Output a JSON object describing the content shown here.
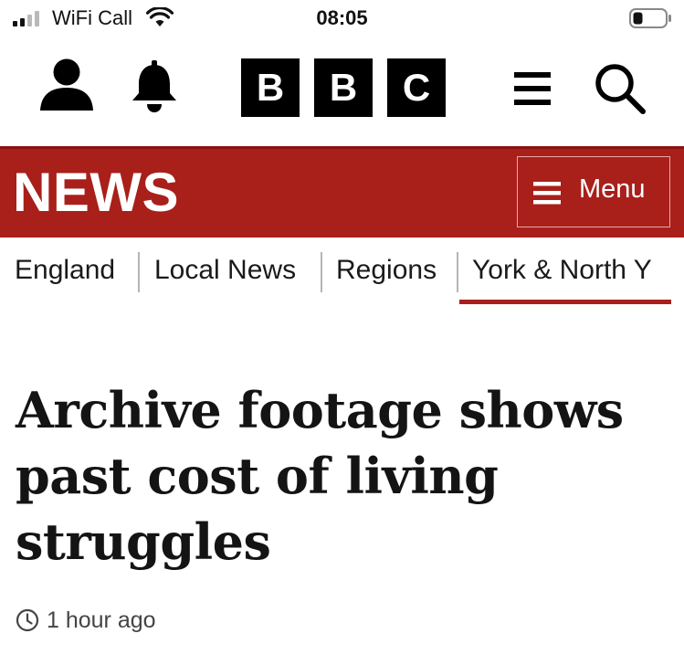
{
  "status_bar": {
    "carrier": "WiFi Call",
    "time": "08:05",
    "icons": [
      "signal-bars-icon",
      "wifi-icon",
      "battery-icon"
    ]
  },
  "header": {
    "logo_letters": [
      "B",
      "B",
      "C"
    ],
    "icons": [
      "account-icon",
      "notifications-bell-icon",
      "hamburger-menu-icon",
      "search-icon"
    ]
  },
  "news_band": {
    "title": "NEWS",
    "menu_label": "Menu",
    "background_color": "#a91f1a"
  },
  "sub_nav": {
    "items": [
      {
        "label": "England"
      },
      {
        "label": "Local News"
      },
      {
        "label": "Regions"
      },
      {
        "label": "York & North Y"
      }
    ],
    "active_index": 3
  },
  "article": {
    "headline": "Archive footage shows past cost of living struggles",
    "timestamp": "1 hour ago"
  }
}
